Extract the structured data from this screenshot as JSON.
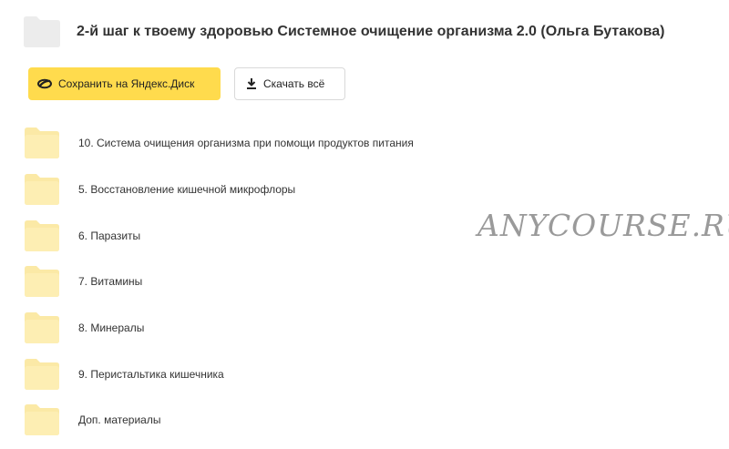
{
  "header": {
    "title": "2-й шаг к твоему здоровью Системное очищение организма 2.0 (Ольга Бутакова)",
    "folder_icon": "folder-icon"
  },
  "actions": {
    "save_label": "Сохранить на Яндекс.Диск",
    "save_icon": "yandex-disk-icon",
    "download_label": "Скачать всё",
    "download_icon": "download-icon"
  },
  "folders": [
    {
      "label": "10. Система очищения организма при помощи продуктов питания"
    },
    {
      "label": "5. Восстановление кишечной микрофлоры"
    },
    {
      "label": "6. Паразиты"
    },
    {
      "label": "7. Витамины"
    },
    {
      "label": "8. Минералы"
    },
    {
      "label": "9. Перистальтика кишечника"
    },
    {
      "label": "Доп. материалы"
    }
  ],
  "watermark": {
    "text": "ANYCOURSE.RU"
  },
  "colors": {
    "accent": "#ffdb4d",
    "folder": "#fbe9a6",
    "header_folder": "#ececec",
    "text": "#333333"
  }
}
